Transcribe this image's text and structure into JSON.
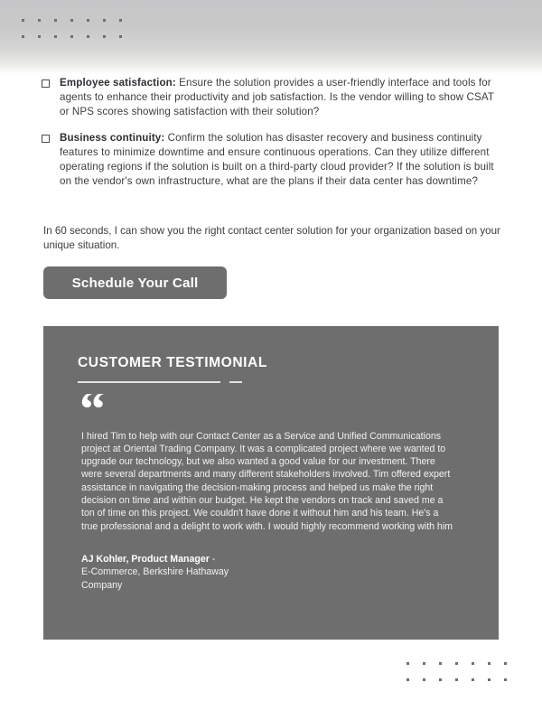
{
  "page": {
    "background_color": "#ffffff",
    "accent_gray": "#6e6e6e",
    "dot_color": "#6f6f72"
  },
  "decor": {
    "top_dots_label": "decorative-dot-grid",
    "bottom_dots_label": "decorative-dot-grid",
    "dot_columns": 7,
    "dot_rows": 2
  },
  "checklist": {
    "items": [
      {
        "checkbox_state": "unchecked",
        "title": "Employee satisfaction:",
        "body": " Ensure the solution provides a user-friendly interface and tools for agents to enhance their productivity and job satisfaction. Is the vendor willing to show CSAT or NPS scores showing satisfaction with their solution?"
      },
      {
        "checkbox_state": "unchecked",
        "title": "Business continuity:",
        "body": " Confirm the solution has disaster recovery and business continuity features to minimize downtime and ensure continuous operations. Can they utilize different operating regions if the solution is built on a third-party cloud provider? If the solution is built on the vendor's own infrastructure, what are the plans if their data center has downtime?"
      }
    ]
  },
  "lead": {
    "text": "In 60 seconds, I can show you the right contact center solution for your organization based on your unique situation."
  },
  "cta": {
    "label": "Schedule Your Call"
  },
  "testimonial": {
    "title": "CUSTOMER TESTIMONIAL",
    "quote_glyph": "“",
    "quote": "I hired Tim to help with our Contact Center as a Service and Unified Communications project at Oriental Trading Company.  It was a complicated project where we wanted to upgrade our technology, but we also wanted a good value for our investment.  There were several departments and many different stakeholders involved.  Tim offered expert assistance in navigating the decision-making process and helped us make the right decision on time and within our budget.  He kept the vendors on track and saved me a ton of time on this project.  We couldn't have done it without him and his team.  He's a true professional and a delight to work with. I would highly recommend working with him",
    "author_name": "AJ Kohler, Product Manager",
    "author_separator": " -",
    "author_company": "E-Commerce, Berkshire Hathaway\nCompany"
  }
}
